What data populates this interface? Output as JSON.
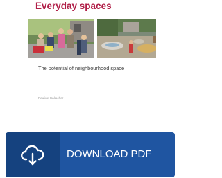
{
  "cover": {
    "title": "Everyday spaces",
    "subtitle": "The potential of neighbourhood space",
    "author": "Pauline Gallacher",
    "title_color": "#b01e47",
    "photos": [
      {
        "name": "street-photo",
        "icon": "photo"
      },
      {
        "name": "playground-photo",
        "icon": "photo"
      }
    ]
  },
  "download": {
    "label": "DOWNLOAD PDF",
    "icon": "cloud-download-icon",
    "color": "#1f55a1",
    "icon_box_color": "#15427f"
  }
}
